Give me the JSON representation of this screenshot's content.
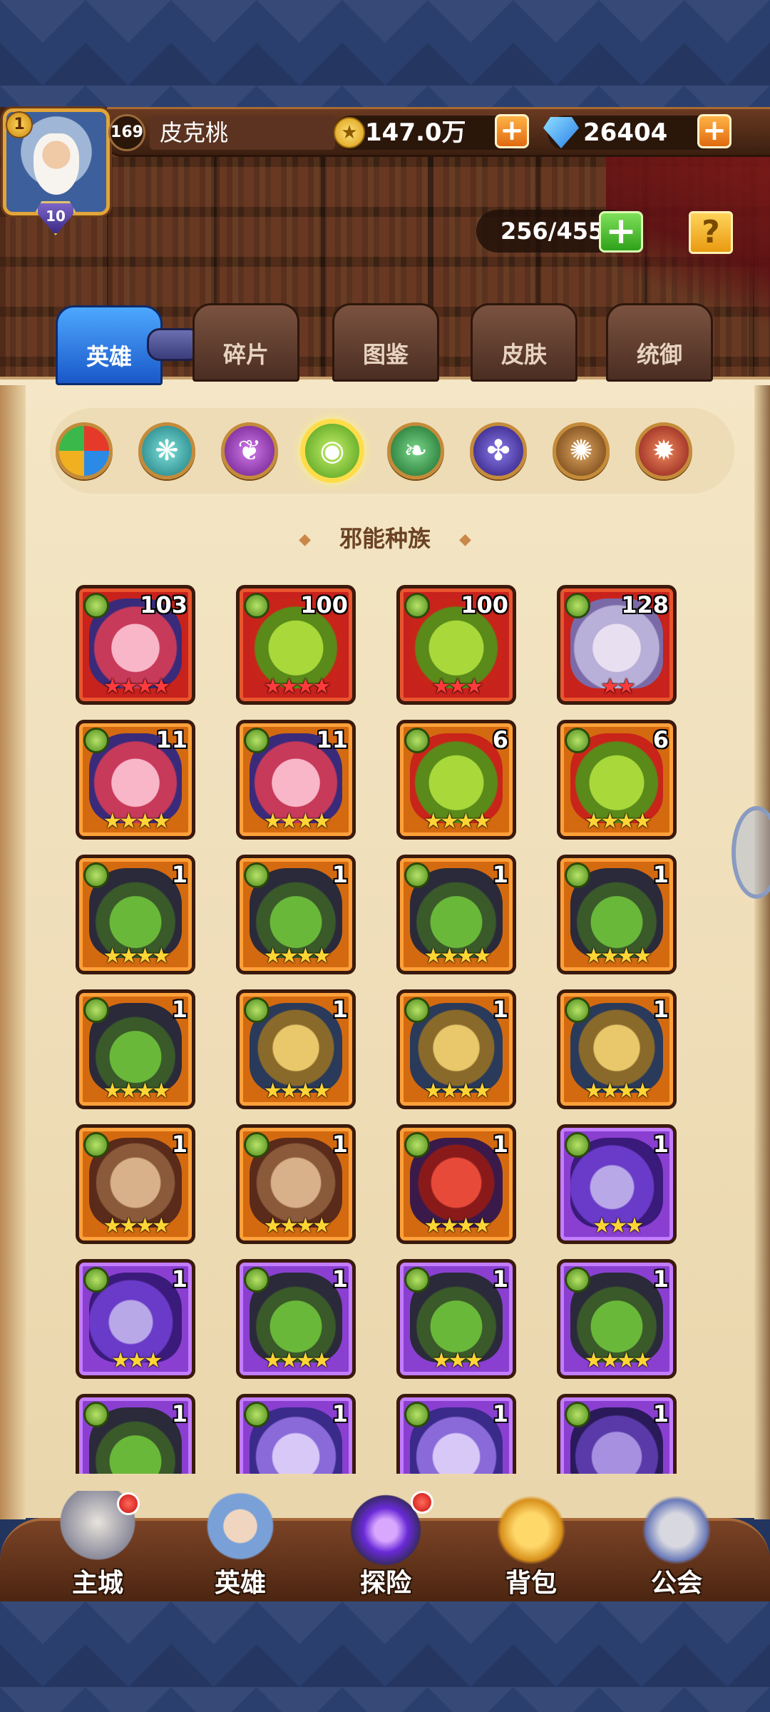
{
  "player": {
    "vip": "1",
    "level": "169",
    "name": "皮克桃",
    "rank": "10"
  },
  "currency": {
    "gold": "147.0万",
    "gems": "26404"
  },
  "inventory": {
    "hero_capacity": "256/455"
  },
  "tabs": [
    {
      "label": "英雄",
      "active": true
    },
    {
      "label": "碎片",
      "active": false
    },
    {
      "label": "图鉴",
      "active": false
    },
    {
      "label": "皮肤",
      "active": false
    },
    {
      "label": "统御",
      "active": false
    }
  ],
  "factions": [
    {
      "name": "all-factions",
      "selected": false
    },
    {
      "name": "shadow",
      "selected": false
    },
    {
      "name": "fortress",
      "selected": false
    },
    {
      "name": "abyss",
      "selected": true
    },
    {
      "name": "forest",
      "selected": false
    },
    {
      "name": "dark",
      "selected": false
    },
    {
      "name": "light",
      "selected": false
    },
    {
      "name": "transcendence",
      "selected": false
    }
  ],
  "race_title": "邪能种族",
  "heroes": [
    {
      "level": "103",
      "frame": "red",
      "stars": "★★★★",
      "star_color": "red",
      "portrait": "pink-demon-girl"
    },
    {
      "level": "100",
      "frame": "red",
      "stars": "★★★★",
      "star_color": "red",
      "portrait": "green-goblin"
    },
    {
      "level": "100",
      "frame": "red",
      "stars": "★★★",
      "star_color": "red",
      "portrait": "green-goblin"
    },
    {
      "level": "128",
      "frame": "red",
      "stars": "★★",
      "star_color": "red",
      "portrait": "white-hair-elf"
    },
    {
      "level": "11",
      "frame": "orange",
      "stars": "★★★★",
      "star_color": "gold",
      "portrait": "pink-demon-girl"
    },
    {
      "level": "11",
      "frame": "orange",
      "stars": "★★★★",
      "star_color": "gold",
      "portrait": "pink-demon-girl"
    },
    {
      "level": "6",
      "frame": "orange",
      "stars": "★★★★",
      "star_color": "gold",
      "portrait": "green-goblin"
    },
    {
      "level": "6",
      "frame": "orange",
      "stars": "★★★★",
      "star_color": "gold",
      "portrait": "green-goblin"
    },
    {
      "level": "1",
      "frame": "orange",
      "stars": "★★★★",
      "star_color": "gold",
      "portrait": "hooded-orc"
    },
    {
      "level": "1",
      "frame": "orange",
      "stars": "★★★★",
      "star_color": "gold",
      "portrait": "hooded-orc"
    },
    {
      "level": "1",
      "frame": "orange",
      "stars": "★★★★",
      "star_color": "gold",
      "portrait": "hooded-orc"
    },
    {
      "level": "1",
      "frame": "orange",
      "stars": "★★★★",
      "star_color": "gold",
      "portrait": "hooded-orc"
    },
    {
      "level": "1",
      "frame": "orange",
      "stars": "★★★★",
      "star_color": "gold",
      "portrait": "hooded-orc"
    },
    {
      "level": "1",
      "frame": "orange",
      "stars": "★★★★",
      "star_color": "gold",
      "portrait": "golden-knight"
    },
    {
      "level": "1",
      "frame": "orange",
      "stars": "★★★★",
      "star_color": "gold",
      "portrait": "golden-knight"
    },
    {
      "level": "1",
      "frame": "orange",
      "stars": "★★★★",
      "star_color": "gold",
      "portrait": "golden-knight"
    },
    {
      "level": "1",
      "frame": "orange",
      "stars": "★★★★",
      "star_color": "gold",
      "portrait": "bald-goblin"
    },
    {
      "level": "1",
      "frame": "orange",
      "stars": "★★★★",
      "star_color": "gold",
      "portrait": "bald-goblin"
    },
    {
      "level": "1",
      "frame": "orange",
      "stars": "★★★★",
      "star_color": "gold",
      "portrait": "red-demon"
    },
    {
      "level": "1",
      "frame": "purple",
      "stars": "★★★",
      "star_color": "gold",
      "portrait": "purple-hair-witch"
    },
    {
      "level": "1",
      "frame": "purple",
      "stars": "★★★",
      "star_color": "gold",
      "portrait": "purple-hair-witch"
    },
    {
      "level": "1",
      "frame": "purple",
      "stars": "★★★★",
      "star_color": "gold",
      "portrait": "hooded-orc"
    },
    {
      "level": "1",
      "frame": "purple",
      "stars": "★★★",
      "star_color": "gold",
      "portrait": "hooded-orc"
    },
    {
      "level": "1",
      "frame": "purple",
      "stars": "★★★★",
      "star_color": "gold",
      "portrait": "hooded-orc"
    },
    {
      "level": "1",
      "frame": "purple",
      "stars": "",
      "star_color": "gold",
      "portrait": "hooded-orc"
    },
    {
      "level": "1",
      "frame": "purple",
      "stars": "",
      "star_color": "gold",
      "portrait": "horned-sorceress"
    },
    {
      "level": "1",
      "frame": "purple",
      "stars": "",
      "star_color": "gold",
      "portrait": "horned-sorceress"
    },
    {
      "level": "1",
      "frame": "purple",
      "stars": "",
      "star_color": "gold",
      "portrait": "purple-imp"
    }
  ],
  "nav": [
    {
      "label": "主城",
      "badge": true,
      "icon": "castle-icon"
    },
    {
      "label": "英雄",
      "badge": false,
      "icon": "hero-icon"
    },
    {
      "label": "探险",
      "badge": true,
      "icon": "portal-icon"
    },
    {
      "label": "背包",
      "badge": false,
      "icon": "backpack-icon"
    },
    {
      "label": "公会",
      "badge": false,
      "icon": "guild-icon"
    }
  ],
  "colors": {
    "active_tab": "#2f7be6",
    "selected_faction_ring": "#ffdd4a",
    "parchment": "#f0dfb9"
  }
}
